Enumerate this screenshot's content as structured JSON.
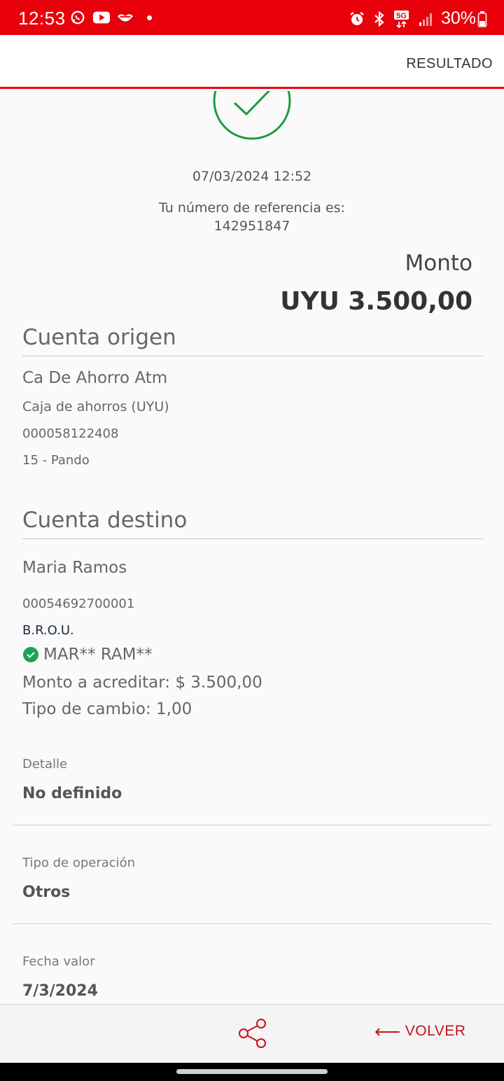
{
  "status_bar": {
    "time": "12:53",
    "battery": "30%",
    "network": "5G",
    "icons": [
      "whatsapp-icon",
      "youtube-icon",
      "handshake-icon",
      "alarm-icon",
      "bluetooth-icon",
      "signal-icon",
      "battery-icon"
    ]
  },
  "app_bar": {
    "title": "RESULTADO"
  },
  "result": {
    "status_icon": "check-circle-icon",
    "datetime": "07/03/2024 12:52",
    "reference_label": "Tu número de referencia es:",
    "reference_number": "142951847",
    "amount_label": "Monto",
    "amount_value": "UYU 3.500,00"
  },
  "origin": {
    "title": "Cuenta origen",
    "name": "Ca De Ahorro Atm",
    "type": "Caja de ahorros (UYU)",
    "number": "000058122408",
    "branch": "15 - Pando"
  },
  "destination": {
    "title": "Cuenta destino",
    "name": "Maria Ramos",
    "number": "00054692700001",
    "bank": "B.R.O.U.",
    "verified_name": "MAR** RAM**",
    "credit_amount": "Monto a acreditar: $ 3.500,00",
    "exchange_rate": "Tipo de cambio: 1,00"
  },
  "details": [
    {
      "label": "Detalle",
      "value": "No definido"
    },
    {
      "label": "Tipo de operación",
      "value": "Otros"
    },
    {
      "label": "Fecha valor",
      "value": "7/3/2024"
    }
  ],
  "bottom_bar": {
    "share_icon": "share-icon",
    "back_label": "VOLVER"
  },
  "colors": {
    "brand_red": "#e8000b",
    "success_green": "#1f9a3b",
    "verified_green": "#1aa355",
    "action_red": "#c8101c"
  }
}
